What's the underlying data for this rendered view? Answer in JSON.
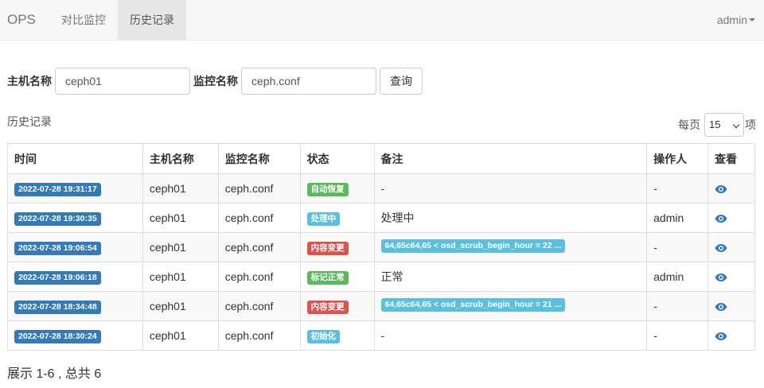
{
  "navbar": {
    "brand": "OPS",
    "tabs": [
      {
        "label": "对比监控",
        "active": false
      },
      {
        "label": "历史记录",
        "active": true
      }
    ],
    "user": "admin"
  },
  "search": {
    "host_label": "主机名称",
    "host_value": "ceph01",
    "monitor_label": "监控名称",
    "monitor_value": "ceph.conf",
    "query_button": "查询"
  },
  "history": {
    "title": "历史记录",
    "per_page_prefix": "每页",
    "per_page_value": "15",
    "per_page_suffix": "项",
    "columns": [
      "时间",
      "主机名称",
      "监控名称",
      "状态",
      "备注",
      "操作人",
      "查看"
    ],
    "rows": [
      {
        "time": "2022-07-28 19:31:17",
        "host": "ceph01",
        "monitor": "ceph.conf",
        "status": "自动恢复",
        "status_color": "#5cb85c",
        "note": "-",
        "note_is_label": false,
        "operator": "-"
      },
      {
        "time": "2022-07-28 19:30:35",
        "host": "ceph01",
        "monitor": "ceph.conf",
        "status": "处理中",
        "status_color": "#5bc0de",
        "note": "处理中",
        "note_is_label": false,
        "operator": "admin"
      },
      {
        "time": "2022-07-28 19:06:54",
        "host": "ceph01",
        "monitor": "ceph.conf",
        "status": "内容变更",
        "status_color": "#d9534f",
        "note": "64,65c64,65 < osd_scrub_begin_hour = 22 ...",
        "note_is_label": true,
        "operator": "-"
      },
      {
        "time": "2022-07-28 19:06:18",
        "host": "ceph01",
        "monitor": "ceph.conf",
        "status": "标记正常",
        "status_color": "#5cb85c",
        "note": "正常",
        "note_is_label": false,
        "operator": "admin"
      },
      {
        "time": "2022-07-28 18:34:48",
        "host": "ceph01",
        "monitor": "ceph.conf",
        "status": "内容变更",
        "status_color": "#d9534f",
        "note": "64,65c64,65 < osd_scrub_begin_hour = 21 ...",
        "note_is_label": true,
        "operator": "-"
      },
      {
        "time": "2022-07-28 18:30:24",
        "host": "ceph01",
        "monitor": "ceph.conf",
        "status": "初始化",
        "status_color": "#5bc0de",
        "note": "-",
        "note_is_label": false,
        "operator": "-"
      }
    ],
    "view_icon": "eye-icon"
  },
  "summary": "展示 1-6 , 总共 6",
  "colors": {
    "time_label": "#337ab7",
    "note_label": "#5bc0de",
    "view_icon": "#337ab7"
  }
}
